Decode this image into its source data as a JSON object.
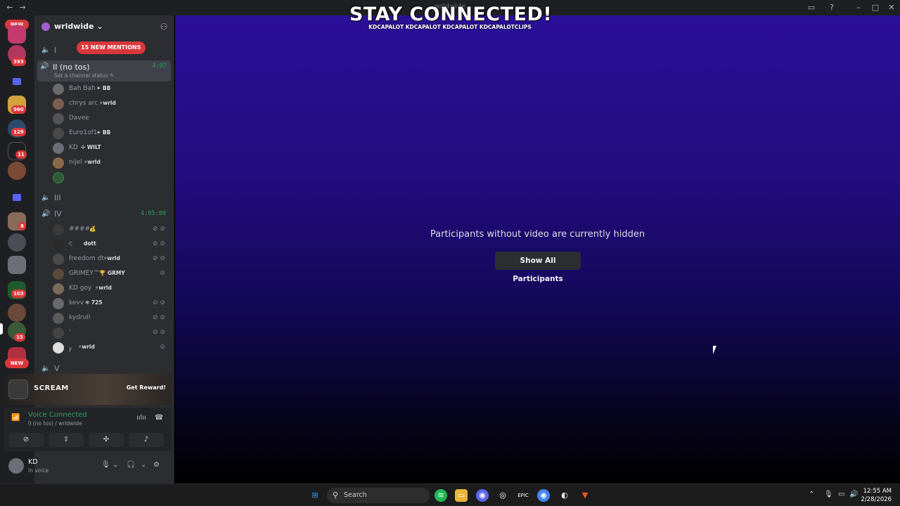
{
  "window": {
    "title": "wrldwide"
  },
  "rail": {
    "top_pill": "NEW",
    "bottom_pill": "NEW",
    "badges": [
      "393",
      "960",
      "129",
      "11",
      "8",
      "103",
      "15"
    ]
  },
  "server": {
    "name": "wrldwide",
    "mentions": "15 NEW MENTIONS"
  },
  "channels": {
    "c1": {
      "name": "I"
    },
    "c2": {
      "name": "II (no tos)",
      "timer": "4:07",
      "status": "Set a channel status"
    },
    "c3": {
      "name": "III"
    },
    "c4": {
      "name": "IV",
      "timer": "4:05:00"
    },
    "c5": {
      "name": "V"
    }
  },
  "members_c2": [
    {
      "name": "Bah Bah",
      "tag": "BB"
    },
    {
      "name": "chrys arc",
      "tag": "wrld"
    },
    {
      "name": "Davee",
      "tag": ""
    },
    {
      "name": "Euro1of1",
      "tag": "BB"
    },
    {
      "name": "KD",
      "tag": "WILT"
    },
    {
      "name": "nijel",
      "tag": "wrld"
    }
  ],
  "members_c4": [
    {
      "name": "####",
      "tag": ""
    },
    {
      "name": "c",
      "tag": "dott"
    },
    {
      "name": "freedom dt",
      "tag": "wrld"
    },
    {
      "name": "GRIMEY™",
      "tag": "GRMY"
    },
    {
      "name": "KD goy",
      "tag": "wrld"
    },
    {
      "name": "kevv",
      "tag": "725"
    },
    {
      "name": "kydrull",
      "tag": ""
    },
    {
      "name": "'",
      "tag": ""
    },
    {
      "name": "ꝩ",
      "tag": "wrld"
    }
  ],
  "promo": {
    "title": "SCREAM",
    "cta": "Get Reward!"
  },
  "voice": {
    "status": "Voice Connected",
    "channel": "II (no tos) / wrldwide"
  },
  "user": {
    "name": "KD",
    "status": "In voice"
  },
  "stream": {
    "overlay_title": "STAY CONNECTED!",
    "socials": "KDCAPALOT  KDCAPALOT  KDCAPALOT  KDCAPALOTCLIPS",
    "hidden_message": "Participants without video are currently hidden",
    "show_all": "Show All Participants"
  },
  "taskbar": {
    "search_placeholder": "Search",
    "time": "12:55 AM",
    "date": "2/28/2026"
  },
  "colors": {
    "accent_green": "#23a55a",
    "mention_red": "#da373c",
    "blurple": "#5865f2"
  }
}
